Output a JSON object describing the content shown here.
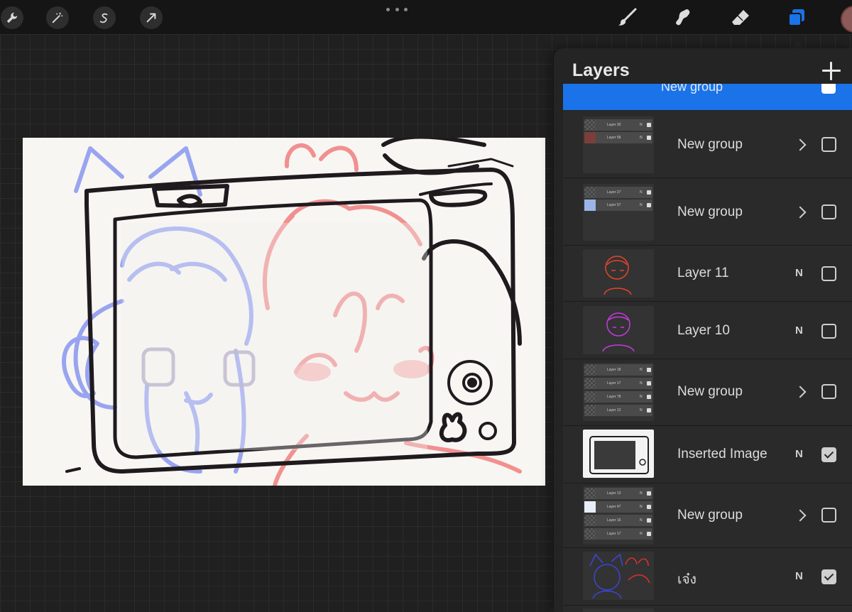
{
  "toolbar": {
    "left_tools": [
      {
        "icon": "wrench-icon"
      },
      {
        "icon": "magic-wand-icon"
      },
      {
        "icon": "selection-s-icon"
      },
      {
        "icon": "transform-arrow-icon"
      }
    ],
    "more_icon": "more-dots-icon",
    "right_tools": [
      {
        "icon": "brush-icon"
      },
      {
        "icon": "smudge-icon"
      },
      {
        "icon": "eraser-icon"
      },
      {
        "icon": "layers-icon",
        "active": true
      }
    ],
    "color_swatch": "#8c5a58"
  },
  "layers_panel": {
    "title": "Layers",
    "add_icon": "plus-icon",
    "selected_row": {
      "label": "New group",
      "visible": true
    },
    "rows": [
      {
        "name": "New group",
        "type": "group",
        "visible": false,
        "mini": [
          {
            "name": "Layer 30",
            "mode": "N"
          },
          {
            "name": "Layer 58",
            "mode": "N"
          }
        ]
      },
      {
        "name": "New group",
        "type": "group",
        "visible": false,
        "mini": [
          {
            "name": "Layer 27",
            "mode": "N"
          },
          {
            "name": "Layer 57",
            "mode": "N"
          }
        ]
      },
      {
        "name": "Layer 11",
        "type": "layer",
        "blend": "N",
        "visible": false
      },
      {
        "name": "Layer 10",
        "type": "layer",
        "blend": "N",
        "visible": false
      },
      {
        "name": "New group",
        "type": "group",
        "visible": false,
        "mini": [
          {
            "name": "Layer 18",
            "mode": "N"
          },
          {
            "name": "Layer 17",
            "mode": "N"
          },
          {
            "name": "Layer 78",
            "mode": "N"
          },
          {
            "name": "Layer 12",
            "mode": "N"
          }
        ]
      },
      {
        "name": "Inserted Image",
        "type": "layer",
        "blend": "N",
        "visible": true
      },
      {
        "name": "New group",
        "type": "group",
        "visible": false,
        "mini": [
          {
            "name": "Layer 13",
            "mode": "N"
          },
          {
            "name": "Layer 47",
            "mode": "N"
          },
          {
            "name": "Layer 16",
            "mode": "N"
          },
          {
            "name": "Layer 17",
            "mode": "N"
          }
        ]
      },
      {
        "name": "เจ๋ง",
        "type": "layer",
        "blend": "N",
        "visible": true
      }
    ]
  },
  "colors": {
    "accent": "#1a73e8",
    "sketch_blue": "#8f9cf0",
    "sketch_red": "#f07f7f",
    "ink": "#1f1a1e"
  }
}
